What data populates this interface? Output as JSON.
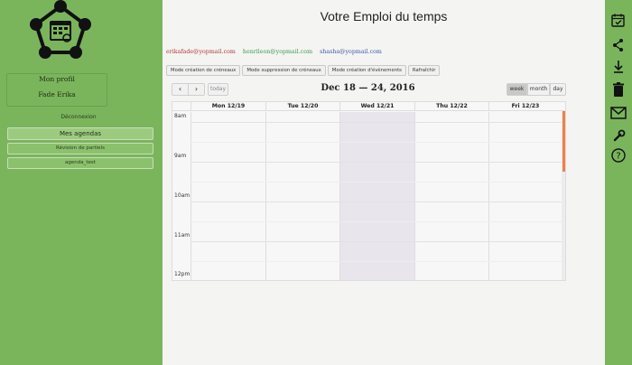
{
  "sidebar": {
    "profile_label": "Mon profil",
    "user_name": "Fade Erika",
    "logout_label": "Déconnexion",
    "agendas_label": "Mes agendas",
    "agendas": [
      "Révision de partiels",
      "agenda_test"
    ]
  },
  "header": {
    "title": "Votre Emploi du temps"
  },
  "users": [
    {
      "email": "erikafade@yopmail.com",
      "color": "#b03a3a"
    },
    {
      "email": "henrileon@yopmail.com",
      "color": "#3d9a52"
    },
    {
      "email": "shasha@yopmail.com",
      "color": "#3c5aa8"
    }
  ],
  "modes": [
    "Mode création de créneaux",
    "Mode suppression de créneaux",
    "Mode création d'évènements",
    "Rafraîchir"
  ],
  "calendar": {
    "prev_icon": "‹",
    "next_icon": "›",
    "today_label": "today",
    "title": "Dec 18 — 24, 2016",
    "views": {
      "week": "week",
      "month": "month",
      "day": "day"
    },
    "days": [
      "Mon 12/19",
      "Tue 12/20",
      "Wed 12/21",
      "Thu 12/22",
      "Fri 12/23"
    ],
    "times": [
      "8am",
      "9am",
      "10am",
      "11am",
      "12pm"
    ]
  },
  "colors": {
    "sidebar_bg": "#7ab55c",
    "today_highlight": "#e8e5ec",
    "scroll_accent": "#f07f4a"
  },
  "toolbar_icons": [
    "calendar-check-icon",
    "share-icon",
    "download-icon",
    "trash-icon",
    "mail-icon",
    "wrench-icon",
    "help-icon"
  ]
}
